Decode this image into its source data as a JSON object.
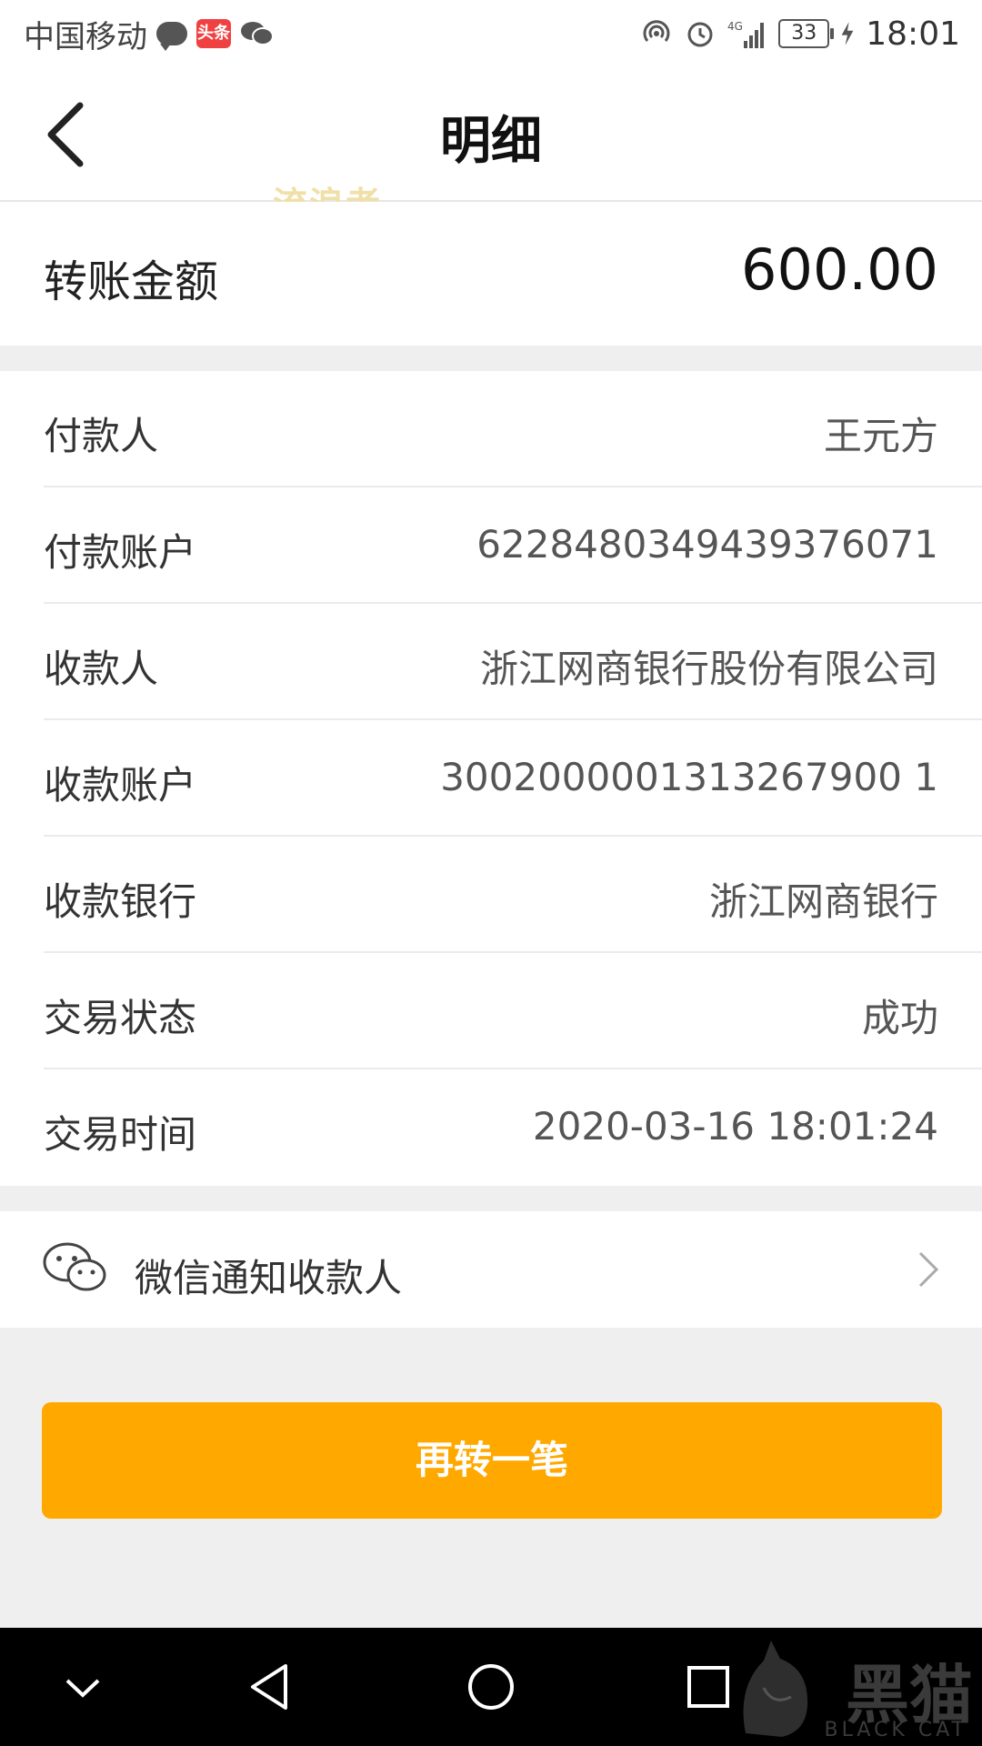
{
  "status_bar": {
    "carrier": "中国移动",
    "toutiao_badge": "头条",
    "battery": "33",
    "time": "18:01",
    "icons": [
      "message-icon",
      "toutiao-icon",
      "wechat-icon",
      "hotspot-icon",
      "alarm-icon",
      "signal-4g-icon",
      "battery-icon",
      "charging-icon"
    ]
  },
  "header": {
    "title": "明细",
    "back_icon": "chevron-left-icon",
    "watermark": "流浪者"
  },
  "amount": {
    "label": "转账金额",
    "value": "600.00"
  },
  "details": [
    {
      "label": "付款人",
      "value": "王元方"
    },
    {
      "label": "付款账户",
      "value": "6228480349439376071"
    },
    {
      "label": "收款人",
      "value": "浙江网商银行股份有限公司"
    },
    {
      "label": "收款账户",
      "value": "3002000001313267900 1"
    },
    {
      "label": "收款银行",
      "value": "浙江网商银行"
    },
    {
      "label": "交易状态",
      "value": "成功"
    },
    {
      "label": "交易时间",
      "value": "2020-03-16 18:01:24"
    }
  ],
  "notify": {
    "label": "微信通知收款人",
    "icon": "wechat-icon"
  },
  "primary_button": {
    "label": "再转一笔",
    "color": "#ffa800"
  },
  "system_nav": {
    "buttons": [
      "collapse-icon",
      "back-triangle-icon",
      "home-circle-icon",
      "recents-square-icon"
    ],
    "brand": "黑猫",
    "brand_sub": "BLACK CAT"
  }
}
